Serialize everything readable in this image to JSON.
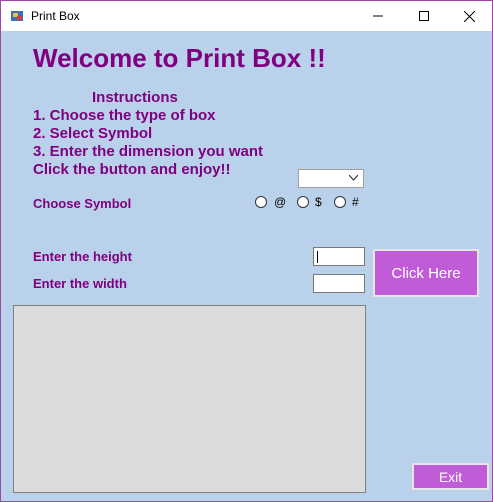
{
  "window": {
    "title": "Print Box"
  },
  "heading": "Welcome to Print Box !!",
  "instructions": {
    "title": "Instructions",
    "lines": [
      "1. Choose the type of box",
      "2. Select Symbol",
      "3. Enter the dimension you want",
      "Click the button and enjoy!!"
    ]
  },
  "box_type": {
    "selected": ""
  },
  "symbol": {
    "label": "Choose Symbol",
    "options": [
      "@",
      "$",
      "#"
    ]
  },
  "height": {
    "label": "Enter the height",
    "value": ""
  },
  "width": {
    "label": "Enter the width",
    "value": ""
  },
  "buttons": {
    "click": "Click Here",
    "exit": "Exit"
  },
  "colors": {
    "accent": "#800080",
    "button": "#c05cd7",
    "background": "#b9d1ea"
  }
}
